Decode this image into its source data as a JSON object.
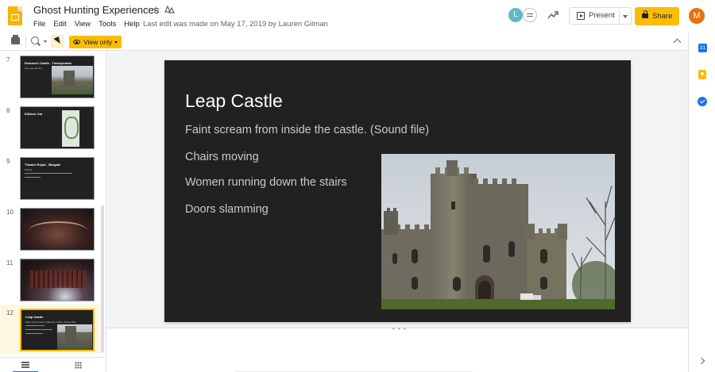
{
  "header": {
    "doc_title": "Ghost Hunting Experiences",
    "last_edit": "Last edit was made on May 17, 2019 by Lauren Gilman",
    "menu": [
      "File",
      "Edit",
      "View",
      "Tools",
      "Help"
    ],
    "collaborator_initial": "L",
    "present_label": "Present",
    "share_label": "Share",
    "account_initial": "M"
  },
  "toolbar": {
    "view_only_label": "View only"
  },
  "filmstrip": {
    "slides": [
      {
        "number": "7",
        "title": "Dracula's Castle - Transylvania",
        "subtitle": "Can you see it's..."
      },
      {
        "number": "8",
        "title": "Killdeer Cat",
        "subtitle": ""
      },
      {
        "number": "9",
        "title": "Theatre Royal - Margate",
        "subtitle": "Pianos"
      },
      {
        "number": "10",
        "title": "",
        "subtitle": ""
      },
      {
        "number": "11",
        "title": "",
        "subtitle": ""
      },
      {
        "number": "12",
        "title": "Leap Castle",
        "subtitle": "Faint scream from inside the castle.  (Sound file)"
      }
    ],
    "active_slide": "12"
  },
  "slide": {
    "title": "Leap Castle",
    "bullets": [
      "Faint scream from inside the castle.  (Sound file)",
      "Chairs moving",
      "Women running down the stairs",
      "Doors slamming"
    ],
    "image": "castle-photo"
  },
  "colors": {
    "accent": "#fbbc04",
    "slide_background": "#212121",
    "canvas_background": "#f1f3f4"
  },
  "icons": [
    "docs-slides-icon",
    "star-icon",
    "move-icon",
    "chat-icon",
    "activity-icon",
    "present-icon",
    "lock-icon",
    "print-icon",
    "zoom-icon",
    "select-icon",
    "eye-icon",
    "collapse-icon",
    "calendar-icon",
    "keep-icon",
    "tasks-icon",
    "expand-icon",
    "list-view-icon",
    "grid-view-icon"
  ]
}
